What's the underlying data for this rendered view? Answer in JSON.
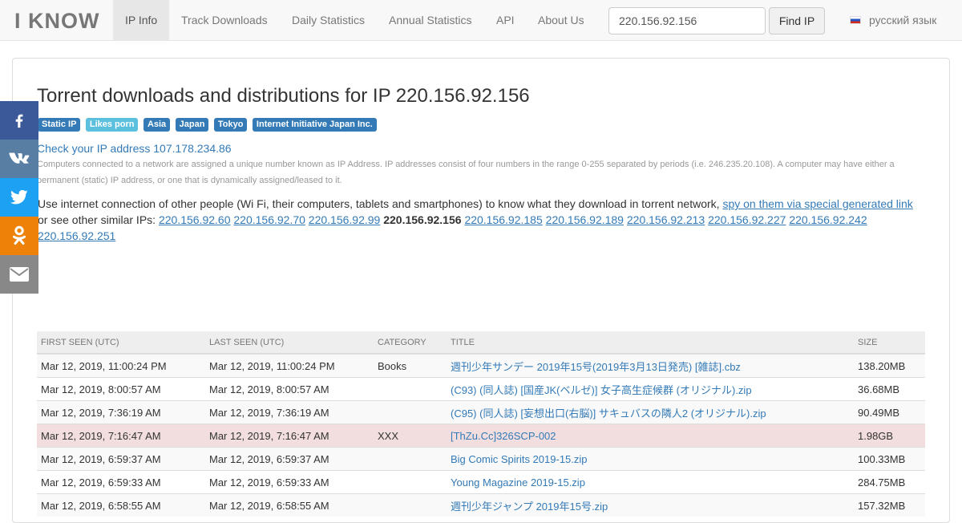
{
  "navbar": {
    "logo": "I KNOW",
    "items": [
      {
        "label": "IP Info",
        "active": true
      },
      {
        "label": "Track Downloads"
      },
      {
        "label": "Daily Statistics"
      },
      {
        "label": "Annual Statistics"
      },
      {
        "label": "API"
      },
      {
        "label": "About Us"
      }
    ],
    "search_value": "220.156.92.156",
    "find_button": "Find IP",
    "language": "русский язык",
    "flag_icon": "russia-flag-icon"
  },
  "page": {
    "title": "Torrent downloads and distributions for IP 220.156.92.156",
    "labels": [
      {
        "text": "Static IP",
        "color": "#337ab7"
      },
      {
        "text": "Likes porn",
        "color": "#5bc0de"
      },
      {
        "text": "Asia",
        "color": "#337ab7"
      },
      {
        "text": "Japan",
        "color": "#337ab7"
      },
      {
        "text": "Tokyo",
        "color": "#337ab7"
      },
      {
        "text": "Internet Initiative Japan Inc.",
        "color": "#337ab7"
      }
    ],
    "check_ip_link": "Check your IP address 107.178.234.86",
    "description": "Computers connected to a network are assigned a unique number known as IP Address. IP addresses consist of four numbers in the range 0-255 separated by periods (i.e. 246.235.20.108). A computer may have either a permanent (static) IP address, or one that is dynamically assigned/leased to it.",
    "people_text": "Use internet connection of other people (Wi Fi, their computers, tablets and smartphones) to know what they download in torrent network,",
    "spy_link": "spy on them via special generated link",
    "similar_text": "or see other similar IPs:",
    "similar_ips": [
      "220.156.92.60",
      "220.156.92.70",
      "220.156.92.99",
      "220.156.92.156",
      "220.156.92.185",
      "220.156.92.189",
      "220.156.92.213",
      "220.156.92.227",
      "220.156.92.242",
      "220.156.92.251"
    ],
    "current_ip": "220.156.92.156"
  },
  "table": {
    "headers": [
      "First seen (UTC)",
      "Last seen (UTC)",
      "Category",
      "Title",
      "Size"
    ],
    "rows": [
      {
        "first": "Mar 12, 2019, 11:00:24 PM",
        "last": "Mar 12, 2019, 11:00:24 PM",
        "category": "Books",
        "title": "週刊少年サンデー 2019年15号(2019年3月13日発売) [雑誌].cbz",
        "size": "138.20MB",
        "highlight": false
      },
      {
        "first": "Mar 12, 2019, 8:00:57 AM",
        "last": "Mar 12, 2019, 8:00:57 AM",
        "category": "",
        "title": "(C93) (同人誌) [国産JK(ベルゼ)] 女子高生症候群 (オリジナル).zip",
        "size": "36.68MB",
        "highlight": false
      },
      {
        "first": "Mar 12, 2019, 7:36:19 AM",
        "last": "Mar 12, 2019, 7:36:19 AM",
        "category": "",
        "title": "(C95) (同人誌) [妄想出口(右脳)] サキュバスの隣人2 (オリジナル).zip",
        "size": "90.49MB",
        "highlight": false
      },
      {
        "first": "Mar 12, 2019, 7:16:47 AM",
        "last": "Mar 12, 2019, 7:16:47 AM",
        "category": "XXX",
        "title": "[ThZu.Cc]326SCP-002",
        "size": "1.98GB",
        "highlight": true
      },
      {
        "first": "Mar 12, 2019, 6:59:37 AM",
        "last": "Mar 12, 2019, 6:59:37 AM",
        "category": "",
        "title": "Big Comic Spirits 2019-15.zip",
        "size": "100.33MB",
        "highlight": false
      },
      {
        "first": "Mar 12, 2019, 6:59:33 AM",
        "last": "Mar 12, 2019, 6:59:33 AM",
        "category": "",
        "title": "Young Magazine 2019-15.zip",
        "size": "284.75MB",
        "highlight": false
      },
      {
        "first": "Mar 12, 2019, 6:58:55 AM",
        "last": "Mar 12, 2019, 6:58:55 AM",
        "category": "",
        "title": "週刊少年ジャンプ 2019年15号.zip",
        "size": "157.32MB",
        "highlight": false
      }
    ]
  },
  "social": [
    {
      "name": "facebook-icon",
      "color": "#3b5998"
    },
    {
      "name": "vk-icon",
      "color": "#587ea3"
    },
    {
      "name": "twitter-icon",
      "color": "#1da1f2"
    },
    {
      "name": "odnoklassniki-icon",
      "color": "#ee8208"
    },
    {
      "name": "email-icon",
      "color": "#888888"
    }
  ]
}
